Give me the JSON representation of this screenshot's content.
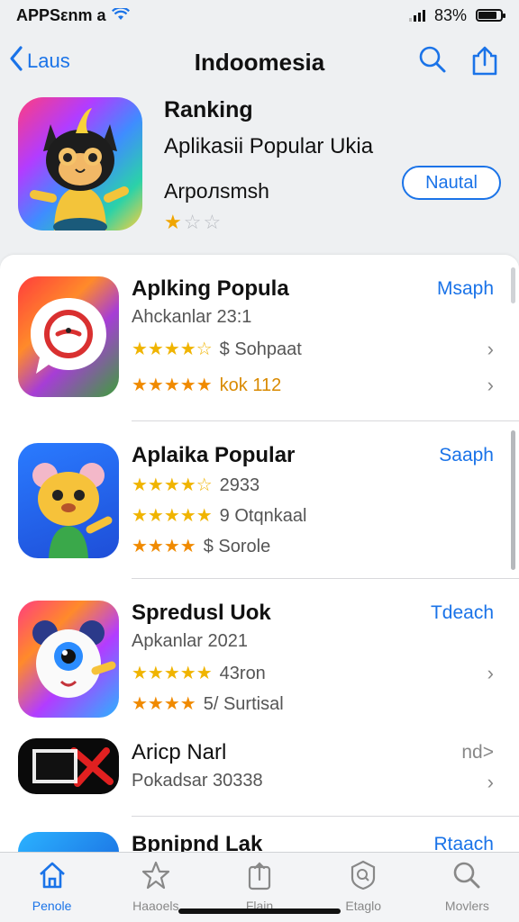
{
  "status_bar": {
    "carrier": "APPSεnm a",
    "battery_percent": "83%",
    "battery_level": 0.83
  },
  "nav": {
    "back_label": "Laus",
    "title": "Indoomesia",
    "search_icon": "search-icon",
    "share_icon": "share-icon"
  },
  "featured": {
    "ranking": "Ranking",
    "subtitle": "Aplikasii Popular Ukia",
    "developer": "Arpoлsmsh",
    "button_label": "Nautal",
    "rating_stars": 1,
    "rating_max": 3
  },
  "apps": [
    {
      "title": "Aplking Popula",
      "action": "Msaph",
      "line1": "Ahckanlar 23:1",
      "line2_stars": "★★★★☆",
      "line2": "$ Sohpaat",
      "line3_stars": "★★★★★",
      "line3": "kok 112",
      "icon": "chat-bubble-icon"
    },
    {
      "title": "Aplaika Popular",
      "action": "Saaph",
      "line1_stars": "★★★★☆",
      "line1": "2933",
      "line2_stars": "★★★★★",
      "line2": "9 Otqnkaal",
      "line3_stars": "★★★★",
      "line3": "$ Sorole",
      "icon": "bear-mascot-icon"
    },
    {
      "title": "Spredusl Uok",
      "action": "Tdeach",
      "line1": "Apkanlar 2021",
      "line2_stars": "★★★★★",
      "line2": "43ron",
      "line3_stars": "★★★★",
      "line3": "5/ Surtisal",
      "icon": "cyclops-mascot-icon"
    },
    {
      "title": "Aricp Narl",
      "action": "nd>",
      "line1": "Pokadsar 30338",
      "icon": "rpmf-pao-logo"
    },
    {
      "title": "Bpnipnd Lak",
      "action": "Rtaach",
      "icon": "partial-app-icon"
    }
  ],
  "tabs": [
    {
      "label": "Penole",
      "icon": "home-icon",
      "active": true
    },
    {
      "label": "Haaoels",
      "icon": "star-icon",
      "active": false
    },
    {
      "label": "Flain",
      "icon": "share-icon",
      "active": false
    },
    {
      "label": "Etaglo",
      "icon": "badge-search-icon",
      "active": false
    },
    {
      "label": "Movlers",
      "icon": "search-icon",
      "active": false
    }
  ],
  "colors": {
    "accent": "#1a73e8",
    "star_gold": "#f0b400",
    "star_orange": "#f08a00"
  }
}
